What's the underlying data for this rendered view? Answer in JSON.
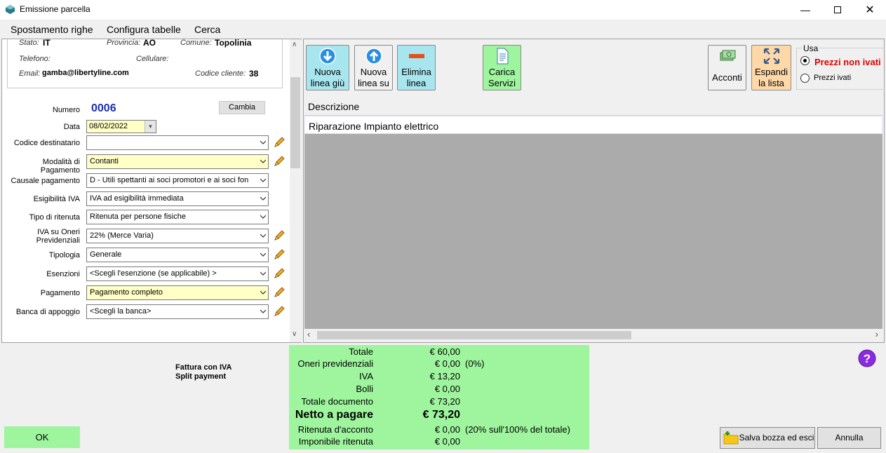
{
  "window": {
    "title": "Emissione parcella"
  },
  "menu": [
    "Spostamento righe",
    "Configura tabelle",
    "Cerca"
  ],
  "client": {
    "stato_label": "Stato:",
    "stato": "IT",
    "provincia_label": "Provincia:",
    "provincia": "AO",
    "comune_label": "Comune:",
    "comune": "Topolinia",
    "telefono_label": "Telefono:",
    "cellulare_label": "Cellulare:",
    "email_label": "Email:",
    "email": "gamba@libertyline.com",
    "codice_label": "Codice cliente:",
    "codice": "38"
  },
  "form": {
    "numero_label": "Numero",
    "numero": "0006",
    "cambia": "Cambia",
    "data_label": "Data",
    "data": "08/02/2022",
    "fields": [
      {
        "label": "Codice destinatario",
        "value": ""
      },
      {
        "label": "Modalità di Pagamento",
        "value": "Contanti"
      },
      {
        "label": "Causale pagamento",
        "value": "D - Utili spettanti ai soci promotori e ai soci fon"
      },
      {
        "label": "Esigibilità IVA",
        "value": "IVA ad esigibilità immediata"
      },
      {
        "label": "Tipo di ritenuta",
        "value": "Ritenuta per persone fisiche"
      },
      {
        "label": "IVA su Oneri Previdenziali",
        "value": "22% (Merce Varia)"
      },
      {
        "label": "Tipologia",
        "value": "Generale"
      },
      {
        "label": "Esenzioni",
        "value": "<Scegli l'esenzione (se applicabile) >"
      },
      {
        "label": "Pagamento",
        "value": "Pagamento completo"
      },
      {
        "label": "Banca di appoggio",
        "value": "<Scegli la banca>"
      }
    ]
  },
  "toolbar": {
    "nuova_giu": [
      "Nuova",
      "linea giù"
    ],
    "nuova_su": [
      "Nuova",
      "linea su"
    ],
    "elimina": [
      "Elimina",
      "linea"
    ],
    "carica": [
      "Carica",
      "Servizi"
    ],
    "acconti": "Acconti",
    "espandi": [
      "Espandi",
      "la lista"
    ],
    "usa_label": "Usa",
    "prezzi_non_ivati": "Prezzi non ivati",
    "prezzi_ivati": "Prezzi ivati"
  },
  "grid": {
    "header": "Descrizione",
    "rows": [
      "Riparazione Impianto elettrico"
    ]
  },
  "note": [
    "Fattura con IVA",
    "Split payment"
  ],
  "totals": {
    "totale_label": "Totale",
    "totale": "€ 60,00",
    "oneri_label": "Oneri previdenziali",
    "oneri": "€ 0,00",
    "oneri_note": "(0%)",
    "iva_label": "IVA",
    "iva": "€ 13,20",
    "bolli_label": "Bolli",
    "bolli": "€ 0,00",
    "totdoc_label": "Totale documento",
    "totdoc": "€ 73,20",
    "netto_label": "Netto a pagare",
    "netto": "€ 73,20",
    "ritenuta_label": "Ritenuta d'acconto",
    "ritenuta": "€ 0,00",
    "ritenuta_note": "(20% sull'100% del totale)",
    "imponibile_label": "Imponibile ritenuta",
    "imponibile": "€ 0,00"
  },
  "buttons": {
    "ok": "OK",
    "salva": "Salva bozza ed esci",
    "annulla": "Annulla"
  },
  "colors": {
    "green": "#9ef59e",
    "yellow_field": "#ffffc6",
    "numero_blue": "#1a2fb0",
    "prezzi_red": "#e00000",
    "help_purple": "#8a2be2"
  }
}
